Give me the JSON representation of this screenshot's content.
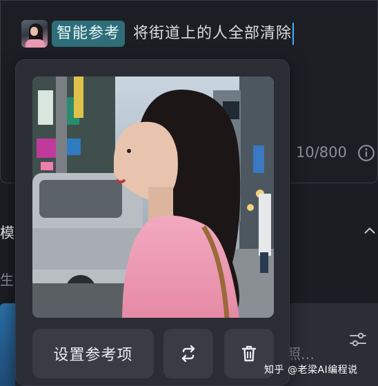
{
  "prompt": {
    "ref_tag": "智能参考",
    "text": "将街道上的人全部清除"
  },
  "editor": {
    "counter": "10/800"
  },
  "sections": {
    "model_label": "模",
    "generate_label": "生"
  },
  "bottom": {
    "hint": "照..."
  },
  "popover": {
    "set_reference_label": "设置参考项",
    "swap_icon": "swap-icon",
    "delete_icon": "trash-icon"
  },
  "watermark": "知乎 @老梁AI编程说",
  "colors": {
    "background": "#1c1d23",
    "ref_tag": "#2f6e78",
    "caret": "#3ab5ff",
    "popover": "#2b2d35",
    "button": "#393b45"
  }
}
